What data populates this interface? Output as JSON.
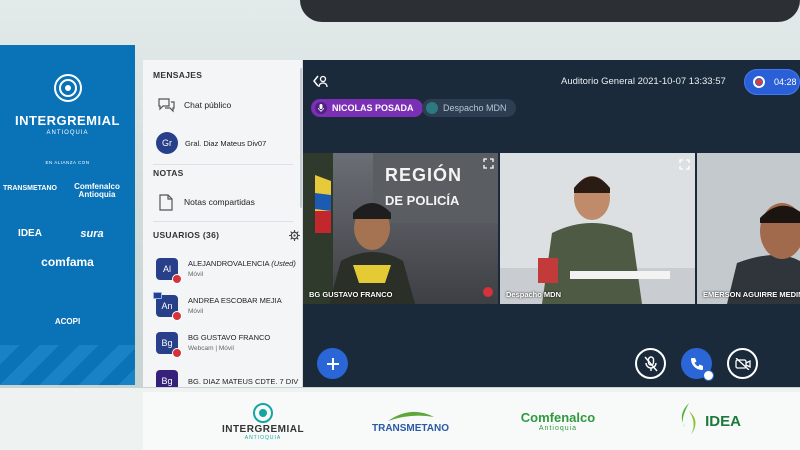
{
  "banner": {
    "brand": "INTERGREMIAL",
    "region": "ANTIOQUIA",
    "alliance": "EN ALIANZA CON",
    "partners": [
      "TRANSMETANO",
      "Comfenalco Antioquia",
      "IDEA",
      "sura",
      "comfama",
      "ACOPI"
    ]
  },
  "sidepanel": {
    "messages_header": "MENSAJES",
    "public_chat": "Chat público",
    "private_chat": {
      "initials": "Gr",
      "name": "Gral. Diaz Mateus Div07"
    },
    "notes_header": "NOTAS",
    "shared_notes": "Notas compartidas",
    "users_header": "USUARIOS (36)",
    "users": [
      {
        "initials": "Al",
        "name": "ALEJANDROVALENCIA",
        "you": "(Usted)",
        "sub": "Móvil"
      },
      {
        "initials": "An",
        "name": "ANDREA ESCOBAR MEJIA",
        "sub": "Móvil"
      },
      {
        "initials": "Bg",
        "name": "BG GUSTAVO FRANCO",
        "sub": "Webcam | Móvil"
      },
      {
        "initials": "Bg",
        "name": "BG. DIAZ MATEUS CDTE. 7 DIV",
        "sub": ""
      }
    ]
  },
  "main": {
    "title": "Auditorio General 2021-10-07 13:33:57",
    "recording_time": "04:28",
    "talking_user": "NICOLAS POSADA",
    "other_user": "Despacho MDN",
    "tiles": [
      {
        "label": "BG GUSTAVO FRANCO",
        "wall_text_1": "REGIÓN",
        "wall_text_2": "DE POLICÍA"
      },
      {
        "label": "Despacho MDN"
      },
      {
        "label": "EMERSON AGUIRRE MEDINA"
      }
    ]
  },
  "sponsors": [
    {
      "name": "INTERGREMIAL",
      "sub": "ANTIOQUIA"
    },
    {
      "name": "TRANSMETANO"
    },
    {
      "name": "Comfenalco",
      "sub": "Antioquia"
    },
    {
      "name": "IDEA"
    }
  ],
  "colors": {
    "accent": "#2a66d6",
    "talker": "#7b2fb5",
    "banner": "#0a72b7",
    "panel_dark": "#1b2a3a"
  }
}
